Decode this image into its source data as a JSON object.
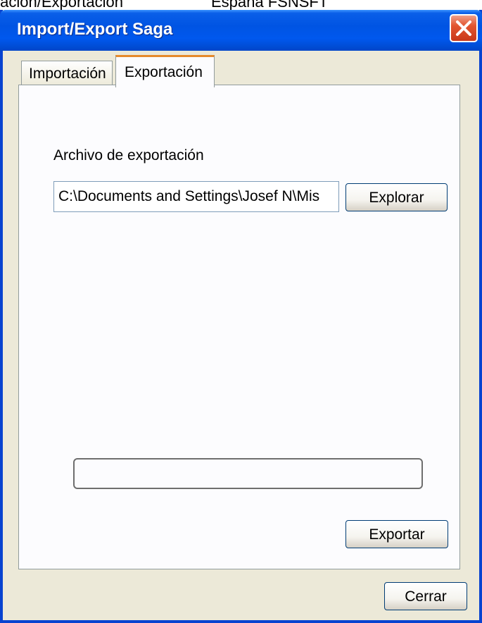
{
  "document_header": {
    "left_text": "tación/Exportación",
    "right_text": "España FSNSFT"
  },
  "window": {
    "title": "Import/Export Saga",
    "close_icon": "close-icon"
  },
  "tabs": [
    {
      "label": "Importación",
      "selected": false
    },
    {
      "label": "Exportación",
      "selected": true
    }
  ],
  "export_tab": {
    "file_label": "Archivo de exportación",
    "file_path": "C:\\Documents and Settings\\Josef N\\Mis",
    "browse_label": "Explorar",
    "progress": 0,
    "export_label": "Exportar"
  },
  "footer": {
    "close_label": "Cerrar"
  },
  "colors": {
    "titlebar": "#0054e3",
    "face": "#ece9d8",
    "selected_tab_accent": "#e68b2c",
    "close_button": "#e2552f"
  }
}
